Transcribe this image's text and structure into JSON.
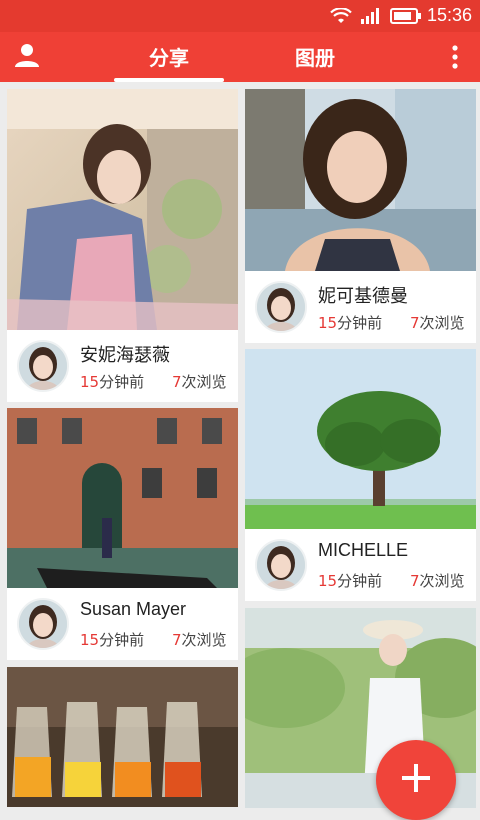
{
  "status": {
    "time": "15:36"
  },
  "appbar": {
    "tab_share": "分享",
    "tab_album": "图册"
  },
  "cards": [
    {
      "name": "安妮海瑟薇",
      "minutes": "15",
      "minutes_suffix": "分钟前",
      "views": "7",
      "views_suffix": "次浏览"
    },
    {
      "name": "妮可基德曼",
      "minutes": "15",
      "minutes_suffix": "分钟前",
      "views": "7",
      "views_suffix": "次浏览"
    },
    {
      "name": "Susan Mayer",
      "minutes": "15",
      "minutes_suffix": "分钟前",
      "views": "7",
      "views_suffix": "次浏览"
    },
    {
      "name": "MICHELLE",
      "minutes": "15",
      "minutes_suffix": "分钟前",
      "views": "7",
      "views_suffix": "次浏览"
    }
  ],
  "icons": {
    "profile": "person-icon",
    "more": "more-vert-icon",
    "fab": "plus-icon"
  },
  "colors": {
    "primary": "#ef4036",
    "status": "#e43a2f",
    "accent_text": "#e53935"
  }
}
